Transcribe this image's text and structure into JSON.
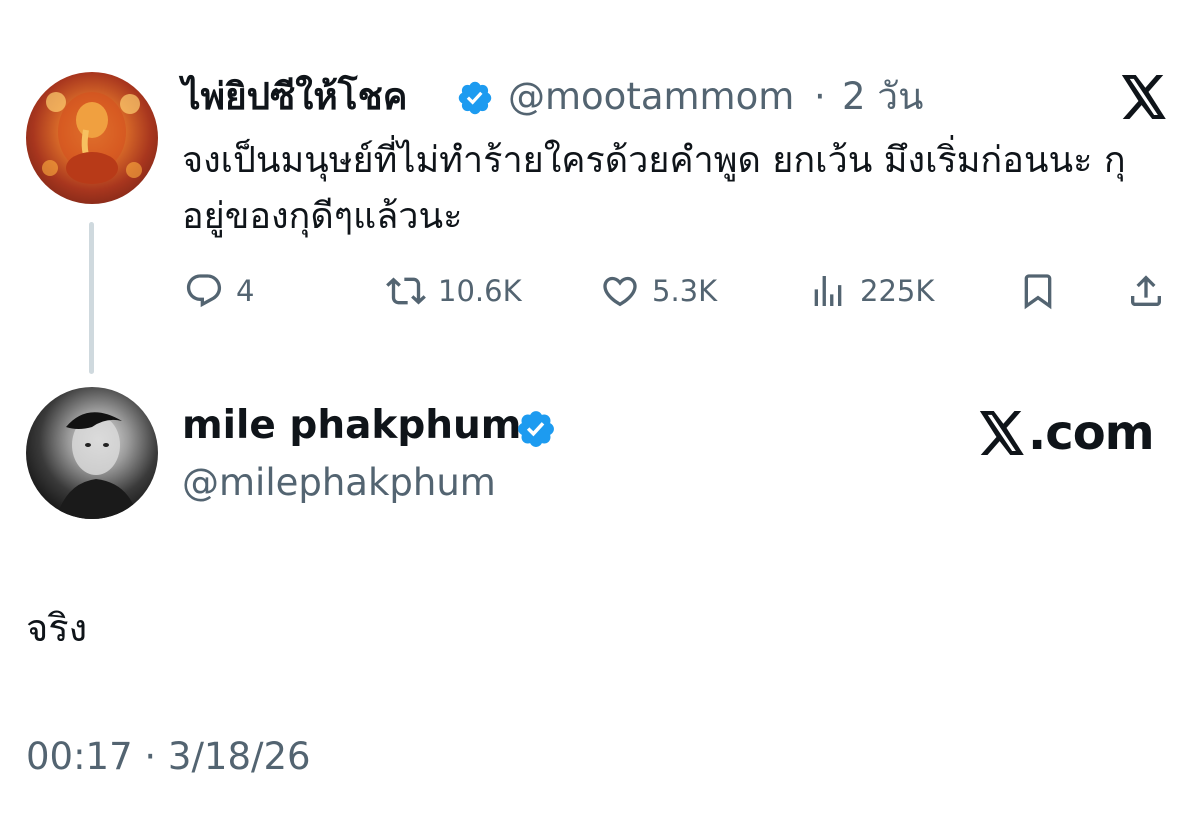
{
  "quoted_tweet": {
    "display_name": "ไพ่ยิปซีให้โชค",
    "handle": "@mootammom",
    "separator": "·",
    "relative_time": "2 วัน",
    "text": "จงเป็นมนุษย์ที่ไม่ทำร้ายใครด้วยคำพูด  ยกเว้น มึงเริ่มก่อนนะ กุอยู่ของกุดีๆแล้วนะ",
    "verified": true,
    "avatar": "ganesha-avatar",
    "stats": {
      "replies": "4",
      "reposts": "10.6K",
      "likes": "5.3K",
      "views": "225K"
    }
  },
  "reply_tweet": {
    "display_name": "mile phakphum",
    "handle": "@milephakphum",
    "verified": true,
    "avatar": "mile-avatar",
    "text": "จริง",
    "timestamp": "00:17",
    "separator": "·",
    "date": "3/18/26",
    "meta": "00:17 · 3/18/26"
  },
  "branding": {
    "x_logo": "x-logo-icon",
    "site_label": ".com"
  },
  "colors": {
    "text_primary": "#0f1419",
    "text_secondary": "#536471",
    "verified_blue": "#1d9bf0",
    "thread_line": "#cfd9de"
  },
  "icons": [
    "reply-icon",
    "repost-icon",
    "like-icon",
    "views-icon",
    "bookmark-icon",
    "share-icon",
    "verified-badge-icon",
    "x-logo-icon"
  ]
}
